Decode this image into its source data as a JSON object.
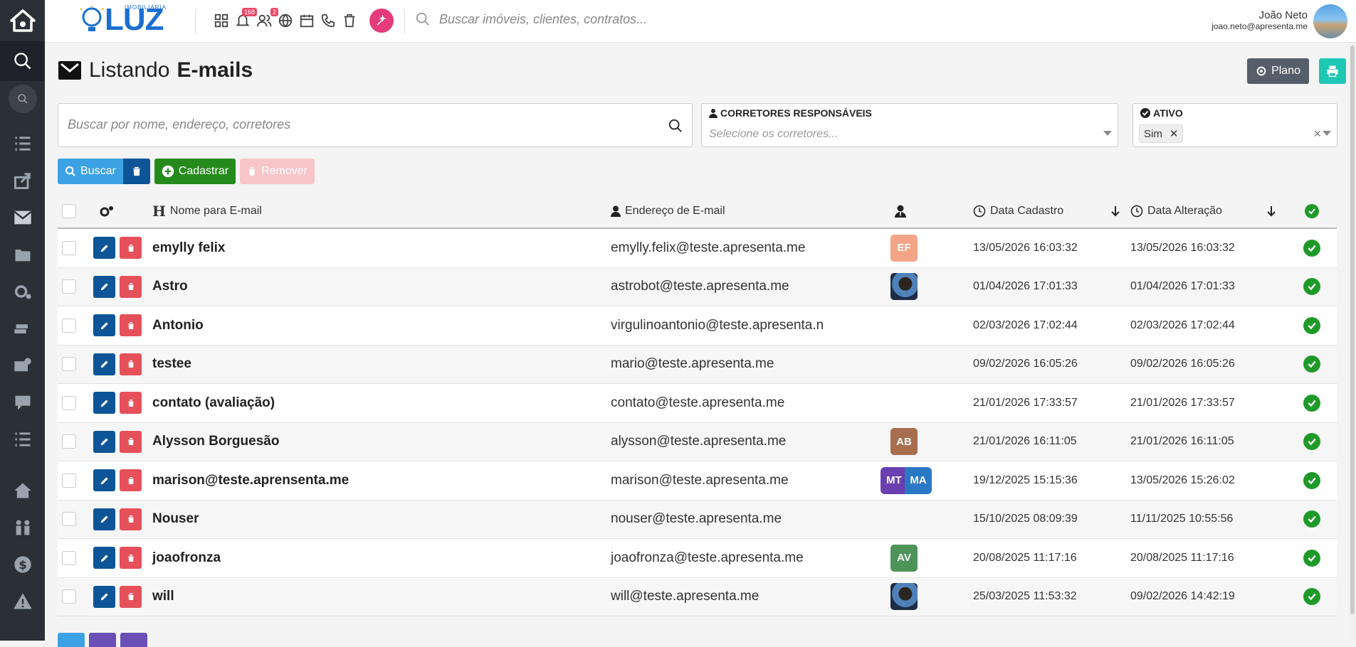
{
  "app": {
    "logo_text": "LUZ",
    "logo_sub": "IMOBILIÁRIA",
    "notifications_badge": "168",
    "users_badge": "2",
    "search_placeholder": "Buscar imóveis, clientes, contratos...",
    "user_name": "João Neto",
    "user_email": "joao.neto@apresenta.me"
  },
  "page": {
    "title_prefix": "Listando",
    "title_bold": "E-mails",
    "plano_label": "Plano"
  },
  "filters": {
    "search_placeholder": "Buscar por nome, endereço, corretores",
    "corretores_label": "CORRETORES RESPONSÁVEIS",
    "corretores_placeholder": "Selecione os corretores...",
    "ativo_label": "ATIVO",
    "ativo_value": "Sim"
  },
  "actions": {
    "buscar": "Buscar",
    "cadastrar": "Cadastrar",
    "remover": "Remover"
  },
  "table": {
    "columns": {
      "nome": "Nome para E-mail",
      "endereco": "Endereço de E-mail",
      "data_cadastro": "Data Cadastro",
      "data_alteracao": "Data Alteração"
    },
    "rows": [
      {
        "nome": "emylly felix",
        "email": "emylly.felix@teste.apresenta.me",
        "avatar": "EF",
        "avatar_color": "#f3a586",
        "cadastro": "13/05/2026 16:03:32",
        "alteracao": "13/05/2026 16:03:32"
      },
      {
        "nome": "Astro",
        "email": "astrobot@teste.apresenta.me",
        "avatar": "photo",
        "avatar_color": "",
        "cadastro": "01/04/2026 17:01:33",
        "alteracao": "01/04/2026 17:01:33"
      },
      {
        "nome": "Antonio",
        "email": "virgulinoantonio@teste.apresenta.n",
        "avatar": "",
        "avatar_color": "",
        "cadastro": "02/03/2026 17:02:44",
        "alteracao": "02/03/2026 17:02:44"
      },
      {
        "nome": "testee",
        "email": "mario@teste.apresenta.me",
        "avatar": "",
        "avatar_color": "",
        "cadastro": "09/02/2026 16:05:26",
        "alteracao": "09/02/2026 16:05:26"
      },
      {
        "nome": "contato (avaliação)",
        "email": "contato@teste.apresenta.me",
        "avatar": "",
        "avatar_color": "",
        "cadastro": "21/01/2026 17:33:57",
        "alteracao": "21/01/2026 17:33:57"
      },
      {
        "nome": "Alysson Borguesão",
        "email": "alysson@teste.apresenta.me",
        "avatar": "AB",
        "avatar_color": "#a86d4e",
        "cadastro": "21/01/2026 16:11:05",
        "alteracao": "21/01/2026 16:11:05"
      },
      {
        "nome": "marison@teste.aprensenta.me",
        "email": "marison@teste.apresenta.me",
        "avatar": "MT",
        "avatar_color": "#6a3fb0",
        "avatar2": "MA",
        "avatar2_color": "#2a78c4",
        "cadastro": "19/12/2025 15:15:36",
        "alteracao": "13/05/2026 15:26:02"
      },
      {
        "nome": "Nouser",
        "email": "nouser@teste.apresenta.me",
        "avatar": "",
        "avatar_color": "",
        "cadastro": "15/10/2025 08:09:39",
        "alteracao": "11/11/2025 10:55:56"
      },
      {
        "nome": "joaofronza",
        "email": "joaofronza@teste.apresenta.me",
        "avatar": "AV",
        "avatar_color": "#4e9458",
        "cadastro": "20/08/2025 11:17:16",
        "alteracao": "20/08/2025 11:17:16"
      },
      {
        "nome": "will",
        "email": "will@teste.apresenta.me",
        "avatar": "photo",
        "avatar_color": "",
        "cadastro": "25/03/2025 11:53:32",
        "alteracao": "09/02/2026 14:42:19"
      }
    ]
  }
}
